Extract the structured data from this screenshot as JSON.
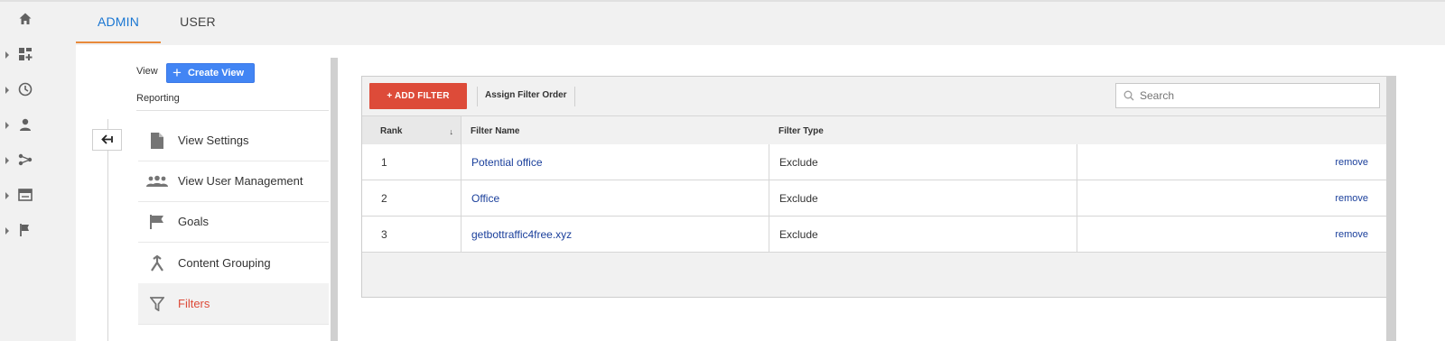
{
  "tabs": [
    {
      "label": "ADMIN",
      "active": true
    },
    {
      "label": "USER",
      "active": false
    }
  ],
  "rail": {
    "icons": [
      "home-icon",
      "dashboard-icon",
      "clock-icon",
      "person-icon",
      "acquisition-icon",
      "behavior-icon",
      "flag-icon"
    ]
  },
  "view_panel": {
    "view_label": "View",
    "create_view_label": "Create View",
    "reporting_label": "Reporting"
  },
  "nav": {
    "items": [
      {
        "label": "View Settings",
        "icon": "document-icon",
        "active": false
      },
      {
        "label": "View User Management",
        "icon": "people-icon",
        "active": false
      },
      {
        "label": "Goals",
        "icon": "flag-icon",
        "active": false
      },
      {
        "label": "Content Grouping",
        "icon": "content-grouping-icon",
        "active": false
      },
      {
        "label": "Filters",
        "icon": "filter-icon",
        "active": true
      }
    ]
  },
  "toolbar": {
    "add_filter_label": "+ ADD FILTER",
    "assign_order_label": "Assign Filter Order",
    "search_placeholder": "Search"
  },
  "table": {
    "columns": [
      "Rank",
      "Filter Name",
      "Filter Type"
    ],
    "rows": [
      {
        "rank": "1",
        "name": "Potential office",
        "type": "Exclude",
        "action": "remove"
      },
      {
        "rank": "2",
        "name": "Office",
        "type": "Exclude",
        "action": "remove"
      },
      {
        "rank": "3",
        "name": "getbottraffic4free.xyz",
        "type": "Exclude",
        "action": "remove"
      }
    ]
  },
  "colors": {
    "accent_blue": "#1976d2",
    "tab_underline": "#e88a3b",
    "add_filter_red": "#dd4b39",
    "active_nav_text": "#dd4b39",
    "link_blue": "#1a3f9b",
    "create_view_blue": "#4285f4"
  }
}
